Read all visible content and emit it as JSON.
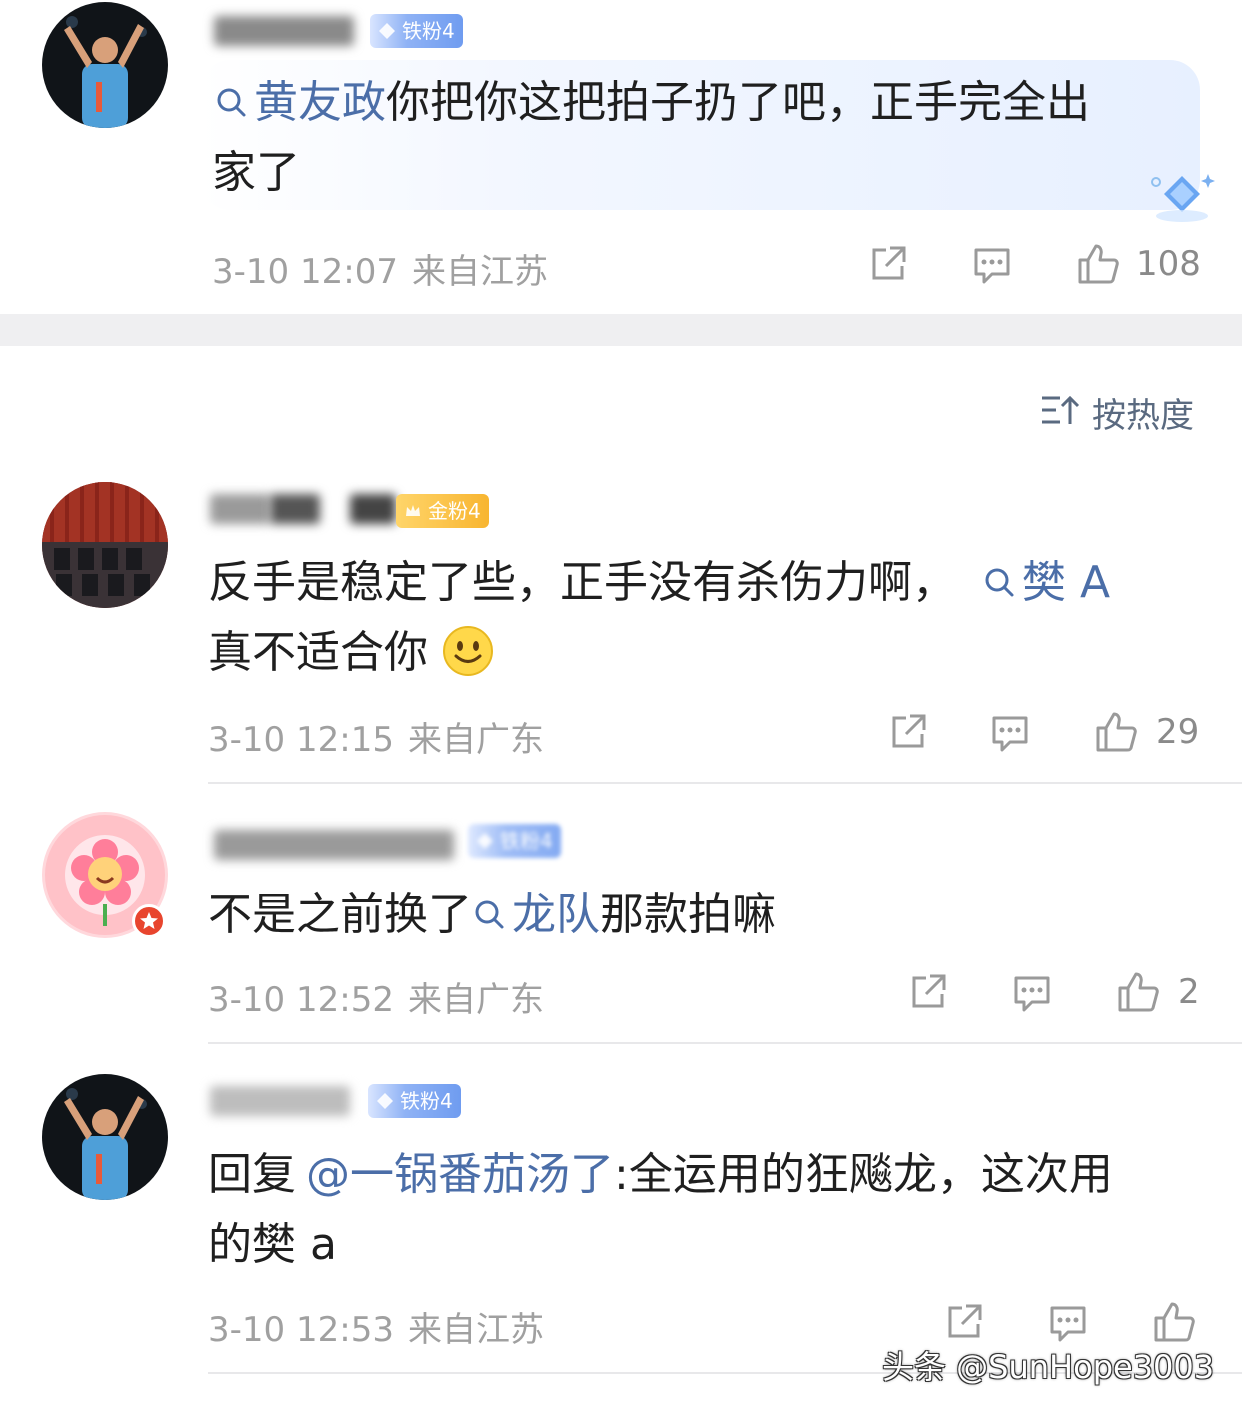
{
  "comments": [
    {
      "badge": "铁粉4",
      "topic": "黄友政",
      "text_line1": "你把你这把拍子扔了吧，正手完全出",
      "text_line2": "家了",
      "time": "3-10 12:07",
      "location": "来自江苏",
      "likes": "108"
    },
    {
      "badge": "金粉4",
      "text_pre": "反手是稳定了些，正手没有杀伤力啊，",
      "topic": "樊 A",
      "text_line2": "真不适合你",
      "time": "3-10 12:15",
      "location": "来自广东",
      "likes": "29"
    },
    {
      "badge": "铁粉4",
      "text_pre": "不是之前换了",
      "topic": "龙队",
      "text_post": "那款拍嘛",
      "time": "3-10 12:52",
      "location": "来自广东",
      "likes": "2"
    },
    {
      "badge": "铁粉4",
      "reply_prefix": "回复",
      "mention": "@一锅番茄汤了",
      "text_post": ":全运用的狂飚龙，这次用",
      "text_line2": "的樊 a",
      "time": "3-10 12:53",
      "location": "来自江苏",
      "likes": ""
    }
  ],
  "sort": {
    "label": "按热度"
  },
  "watermark": "头条 @SunHope3003",
  "colors": {
    "link": "#4b6ea8",
    "meta": "#a0a0a0",
    "divider": "#efeff1"
  },
  "icons": [
    "search-icon",
    "share-icon",
    "reply-icon",
    "like-icon",
    "sort-icon",
    "smile-emoji",
    "diamond-icon"
  ]
}
